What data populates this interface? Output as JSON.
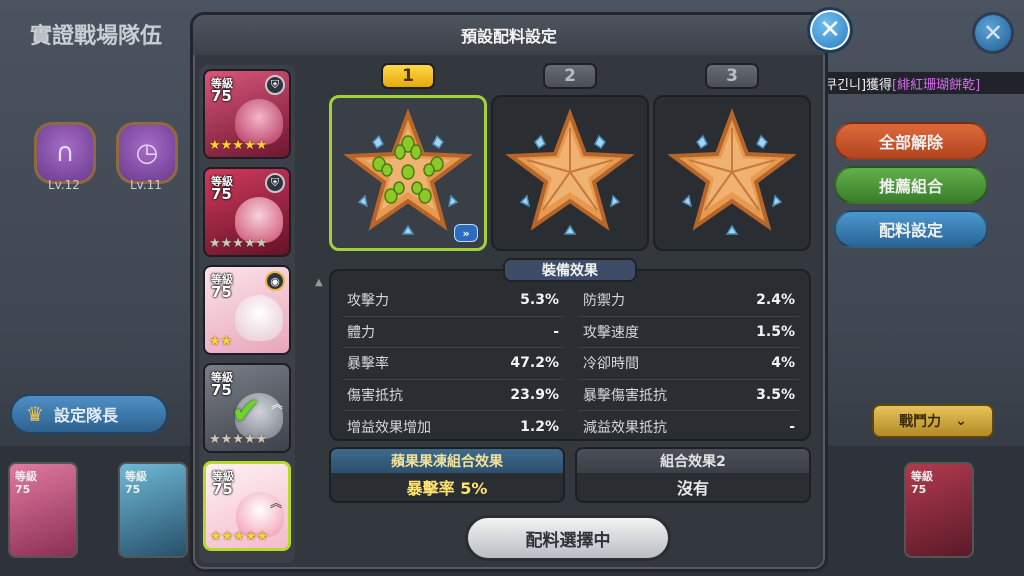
{
  "background": {
    "title": "實證戰場隊伍",
    "badges": [
      {
        "level": "Lv.12",
        "icon": "horseshoe-icon"
      },
      {
        "level": "Lv.11",
        "icon": "clock-icon"
      }
    ],
    "leader_button": "設定隊長",
    "reward_banner": {
      "prefix": "[쿠긴니]獲得",
      "item": "[緋紅珊瑚餅乾]"
    },
    "buttons": {
      "unequip_all": "全部解除",
      "recommend": "推薦組合",
      "preset": "配料設定"
    },
    "power_button": "戰鬥力",
    "cards": [
      {
        "level_label": "等級",
        "level": "75"
      },
      {
        "level_label": "等級",
        "level": "75"
      },
      {
        "level_label": "等級",
        "level": "75"
      }
    ]
  },
  "modal": {
    "title": "預設配料設定",
    "slots": [
      {
        "label": "1",
        "active": true
      },
      {
        "label": "2",
        "active": false
      },
      {
        "label": "3",
        "active": false
      }
    ],
    "cookies": [
      {
        "level_label": "等級",
        "level": "75",
        "stars": 5,
        "badge": "shield-icon"
      },
      {
        "level_label": "等級",
        "level": "75",
        "stars": 5,
        "badge": "shield-icon"
      },
      {
        "level_label": "等級",
        "level": "75",
        "stars": 2,
        "badge": "eye-icon"
      },
      {
        "level_label": "等級",
        "level": "75",
        "stars": 5,
        "checked": true
      },
      {
        "level_label": "等級",
        "level": "75",
        "stars": 5,
        "selected": true
      }
    ],
    "effects_title": "裝備效果",
    "stats": [
      {
        "label": "攻擊力",
        "value": "5.3%"
      },
      {
        "label": "防禦力",
        "value": "2.4%"
      },
      {
        "label": "體力",
        "value": "-"
      },
      {
        "label": "攻擊速度",
        "value": "1.5%"
      },
      {
        "label": "暴擊率",
        "value": "47.2%"
      },
      {
        "label": "冷卻時間",
        "value": "4%"
      },
      {
        "label": "傷害抵抗",
        "value": "23.9%"
      },
      {
        "label": "暴擊傷害抵抗",
        "value": "3.5%"
      },
      {
        "label": "增益效果增加",
        "value": "1.2%"
      },
      {
        "label": "減益效果抵抗",
        "value": "-"
      }
    ],
    "set1": {
      "title": "蘋果果凍組合效果",
      "value": "暴擊率 5%"
    },
    "set2": {
      "title": "組合效果2",
      "value": "沒有"
    },
    "select_button": "配料選擇中",
    "colors": {
      "accent_yellow": "#ffd84a",
      "active_border": "#a2d238",
      "jelly_green": "#8bc92a",
      "star_orange": "#e79a4f"
    }
  }
}
